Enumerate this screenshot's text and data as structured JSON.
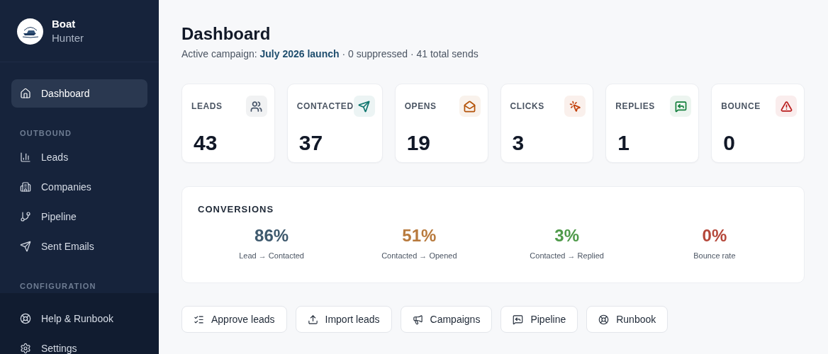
{
  "brand": {
    "name": "Boat",
    "subtitle": "Hunter"
  },
  "sidebar": {
    "items": [
      {
        "label": "Dashboard",
        "selected": true
      }
    ],
    "sections": [
      {
        "label": "OUTBOUND",
        "items": [
          {
            "label": "Leads",
            "selected": false
          },
          {
            "label": "Companies",
            "selected": false
          },
          {
            "label": "Pipeline",
            "selected": false
          },
          {
            "label": "Sent Emails",
            "selected": false
          }
        ]
      },
      {
        "label": "CONFIGURATION"
      }
    ],
    "footer_items": [
      {
        "label": "Help & Runbook",
        "selected": false
      },
      {
        "label": "Settings",
        "selected": false
      }
    ]
  },
  "header": {
    "title": "Dashboard",
    "subtitle_prefix": "Active campaign:",
    "campaign_link": "July 2026 launch",
    "subtitle_suffix": "· 0 suppressed · 41 total sends"
  },
  "stats": [
    {
      "label": "LEADS",
      "value": "43",
      "color": "#475569"
    },
    {
      "label": "CONTACTED",
      "value": "37",
      "color": "#0f766e"
    },
    {
      "label": "OPENS",
      "value": "19",
      "color": "#b45309"
    },
    {
      "label": "CLICKS",
      "value": "3",
      "color": "#c2410c"
    },
    {
      "label": "REPLIES",
      "value": "1",
      "color": "#15803d"
    },
    {
      "label": "BOUNCE",
      "value": "0",
      "color": "#b91c1c"
    }
  ],
  "conversions": {
    "title": "CONVERSIONS",
    "items": [
      {
        "value": "86%",
        "label": "Lead → Contacted",
        "color": "#3f5a6e"
      },
      {
        "value": "51%",
        "label": "Contacted → Opened",
        "color": "#b87a3d"
      },
      {
        "value": "3%",
        "label": "Contacted → Replied",
        "color": "#4f9a4a"
      },
      {
        "value": "0%",
        "label": "Bounce rate",
        "color": "#b5473a"
      }
    ]
  },
  "actions": [
    "Approve leads",
    "Import leads",
    "Campaigns",
    "Pipeline",
    "Runbook"
  ]
}
